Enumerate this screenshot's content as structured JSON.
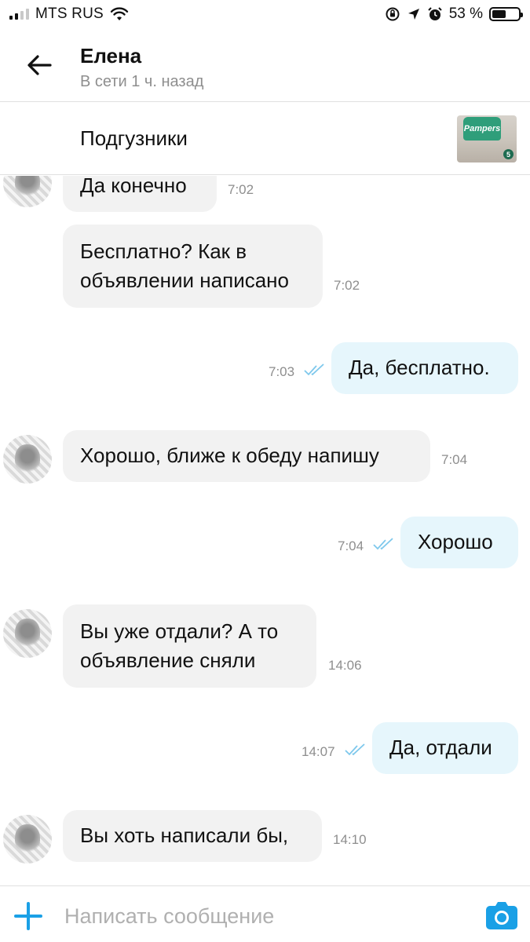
{
  "status_bar": {
    "carrier": "MTS RUS",
    "battery_text": "53 %",
    "battery_level": 0.53
  },
  "header": {
    "contact_name": "Елена",
    "contact_status": "В сети 1 ч. назад"
  },
  "listing": {
    "title": "Подгузники",
    "thumb_brand": "Pampers",
    "thumb_size": "5"
  },
  "messages": [
    {
      "direction": "in",
      "text": "Да конечно",
      "time": "7:02"
    },
    {
      "direction": "in",
      "text": "Бесплатно? Как в объявлении написано",
      "time": "7:02"
    },
    {
      "direction": "out",
      "text": "Да, бесплатно.",
      "time": "7:03",
      "read": true
    },
    {
      "direction": "in",
      "text": "Хорошо, ближе к обеду напишу",
      "time": "7:04"
    },
    {
      "direction": "out",
      "text": "Хорошо",
      "time": "7:04",
      "read": true
    },
    {
      "direction": "in",
      "text": "Вы уже отдали? А то объявление сняли",
      "time": "14:06"
    },
    {
      "direction": "out",
      "text": "Да, отдали",
      "time": "14:07",
      "read": true
    },
    {
      "direction": "in",
      "text": "Вы хоть написали бы,",
      "time": "14:10"
    }
  ],
  "input": {
    "placeholder": "Написать сообщение"
  },
  "colors": {
    "accent": "#1aa0e6",
    "incoming_bubble": "#f2f2f2",
    "outgoing_bubble": "#e6f6fc",
    "read_ticks": "#7ec8ec"
  }
}
